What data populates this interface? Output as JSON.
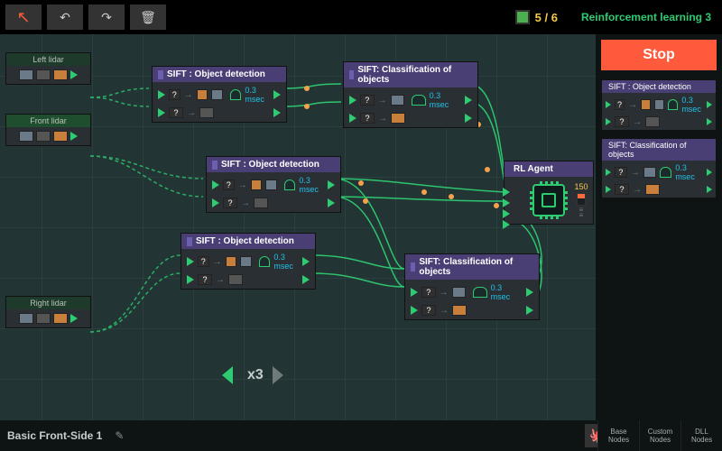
{
  "toolbar": {
    "cursor": "↖",
    "undo": "↶",
    "redo": "↷",
    "trash": "🗑"
  },
  "resource": {
    "used": "5",
    "total": "6"
  },
  "level_name": "Reinforcement learning 3",
  "stop_label": "Stop",
  "lidars": {
    "left": {
      "label": "Left lidar"
    },
    "front": {
      "label": "Front lidar"
    },
    "right": {
      "label": "Right lidar"
    }
  },
  "nodes": {
    "sift_detect": {
      "title": "SIFT : Object detection",
      "latency": "0.3 msec",
      "in_label": "?"
    },
    "sift_class": {
      "title": "SIFT: Classification of objects",
      "latency": "0.3 msec",
      "in_label": "?"
    },
    "rl_agent": {
      "title": "RL Agent",
      "value": "150"
    }
  },
  "palette": {
    "detect": {
      "title": "SIFT : Object detection",
      "latency": "0.3 msec"
    },
    "class": {
      "title": "SIFT: Classification of objects",
      "latency": "0.3 msec"
    }
  },
  "zoom": {
    "factor": "x3"
  },
  "scheme_name": "Basic Front-Side 1",
  "categories": {
    "base": "Base\nNodes",
    "custom": "Custom\nNodes",
    "dll": "DLL\nNodes"
  }
}
